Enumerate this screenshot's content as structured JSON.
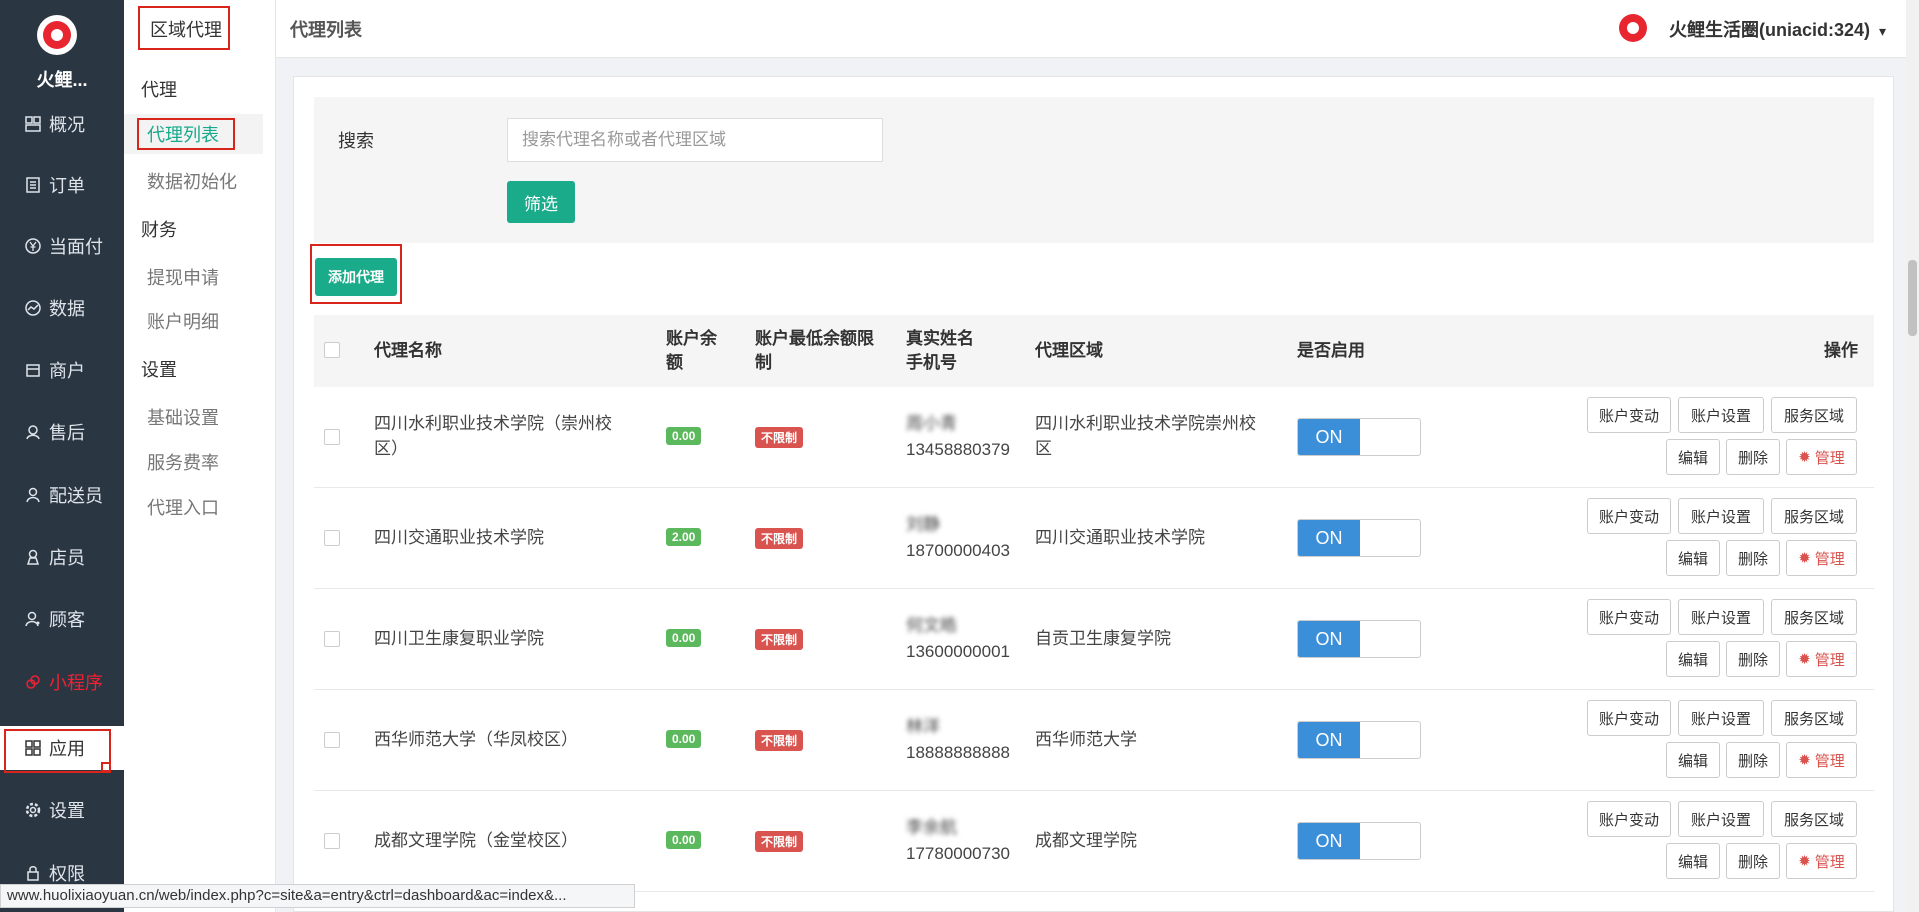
{
  "nav": {
    "brand": "火鲤...",
    "items": [
      {
        "label": "概况",
        "icon": "dashboard-icon"
      },
      {
        "label": "订单",
        "icon": "order-icon"
      },
      {
        "label": "当面付",
        "icon": "yuan-icon"
      },
      {
        "label": "数据",
        "icon": "chart-icon"
      },
      {
        "label": "商户",
        "icon": "store-icon"
      },
      {
        "label": "售后",
        "icon": "service-icon"
      },
      {
        "label": "配送员",
        "icon": "courier-icon"
      },
      {
        "label": "店员",
        "icon": "clerk-icon"
      },
      {
        "label": "顾客",
        "icon": "customer-icon"
      },
      {
        "label": "小程序",
        "icon": "miniprogram-icon"
      },
      {
        "label": "应用",
        "icon": "apps-icon"
      },
      {
        "label": "设置",
        "icon": "settings-icon"
      },
      {
        "label": "权限",
        "icon": "permission-icon"
      }
    ]
  },
  "submenu": {
    "title": "区域代理",
    "groups": [
      {
        "label": "代理",
        "links": [
          "代理列表",
          "数据初始化"
        ]
      },
      {
        "label": "财务",
        "links": [
          "提现申请",
          "账户明细"
        ]
      },
      {
        "label": "设置",
        "links": [
          "基础设置",
          "服务费率",
          "代理入口"
        ]
      }
    ]
  },
  "header": {
    "title": "代理列表",
    "user": "火鲤生活圈(uniacid:324)",
    "caret": "▾"
  },
  "search": {
    "label": "搜索",
    "placeholder": "搜索代理名称或者代理区域",
    "filter_button": "筛选"
  },
  "add_button": "添加代理",
  "table": {
    "headers": {
      "name": "代理名称",
      "balance": "账户余额",
      "min_balance": "账户最低余额限制",
      "real_name": "真实姓名",
      "phone": "手机号",
      "area": "代理区域",
      "enabled": "是否启用",
      "actions": "操作"
    },
    "rows": [
      {
        "name": "四川水利职业技术学院（崇州校区）",
        "balance": "0.00",
        "limit": "不限制",
        "real_name": "周小青",
        "phone": "13458880379",
        "area": "四川水利职业技术学院崇州校区",
        "enabled": "ON"
      },
      {
        "name": "四川交通职业技术学院",
        "balance": "2.00",
        "limit": "不限制",
        "real_name": "刘静",
        "phone": "18700000403",
        "area": "四川交通职业技术学院",
        "enabled": "ON"
      },
      {
        "name": "四川卫生康复职业学院",
        "balance": "0.00",
        "limit": "不限制",
        "real_name": "何文皓",
        "phone": "13600000001",
        "area": "自贡卫生康复学院",
        "enabled": "ON"
      },
      {
        "name": "西华师范大学（华凤校区）",
        "balance": "0.00",
        "limit": "不限制",
        "real_name": "林洋",
        "phone": "18888888888",
        "area": "西华师范大学",
        "enabled": "ON"
      },
      {
        "name": "成都文理学院（金堂校区）",
        "balance": "0.00",
        "limit": "不限制",
        "real_name": "李余航",
        "phone": "17780000730",
        "area": "成都文理学院",
        "enabled": "ON"
      }
    ],
    "action_labels": {
      "account_change": "账户变动",
      "account_settings": "账户设置",
      "service_area": "服务区域",
      "edit": "编辑",
      "delete": "删除",
      "manage": "管理"
    }
  },
  "status_bar": "www.huolixiaoyuan.cn/web/index.php?c=site&a=entry&ctrl=dashboard&ac=index&...",
  "colors": {
    "accent": "#1aab8a",
    "toggle_on": "#3b8fd8",
    "danger": "#d9534f",
    "success": "#5cb85c",
    "nav_bg": "#2b3643"
  }
}
